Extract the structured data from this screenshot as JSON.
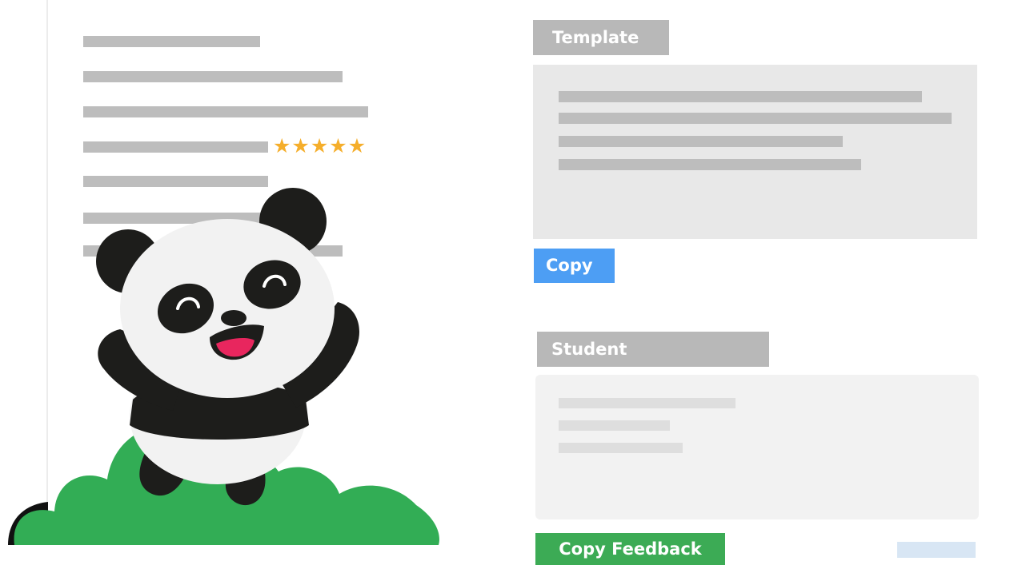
{
  "template": {
    "header_label": "Template",
    "copy_label": "Copy"
  },
  "student": {
    "header_label": "Student",
    "feedback_label": "Copy Feedback"
  },
  "review": {
    "rating": 5,
    "rating_max": 5
  },
  "colors": {
    "star": "#f5ae2b",
    "copy_button": "#4d9ef4",
    "feedback_button": "#3cab55",
    "header_tag": "#b8b8b8",
    "placeholder": "#bdbdbd",
    "panda_bush": "#32ad55",
    "panda_mouth": "#e8265e"
  },
  "icons": {
    "rating": "star-icon",
    "mascot": "panda-mascot"
  }
}
